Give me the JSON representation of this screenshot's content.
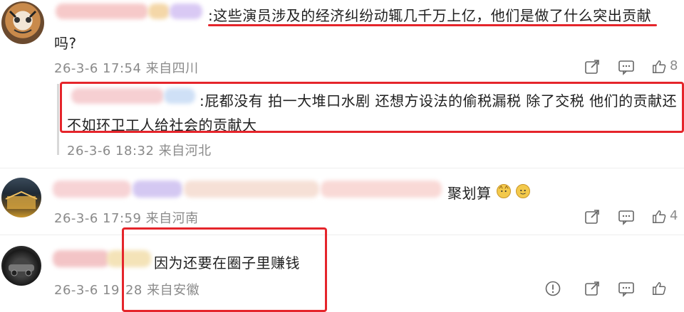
{
  "comments": [
    {
      "text_line1": ":这些演员涉及的经济纠纷动辄几千万上亿，他们是做了什么突出贡献",
      "text_line2": "吗?",
      "date": "26-3-6",
      "time": "17:54",
      "location": "来自四川",
      "like_count": "8",
      "reply": {
        "text_line1": ":屁都没有 拍一大堆口水剧 还想方设法的偷税漏税 除了交税 他们的贡献还",
        "text_line2": "不如环卫工人给社会的贡献大",
        "date": "26-3-6",
        "time": "18:32",
        "location": "来自河北"
      }
    },
    {
      "text": "聚划算",
      "date": "26-3-6",
      "time": "17:59",
      "location": "来自河南",
      "like_count": "4"
    },
    {
      "text": "因为还要在圈子里赚钱",
      "date": "26-3-6",
      "time_part1": "19",
      "time_part2": "28",
      "location": "来自安徽"
    }
  ],
  "colors": {
    "highlight": "#e5252b",
    "meta": "#8a8a8a"
  },
  "icons": [
    "share-icon",
    "comment-icon",
    "like-icon",
    "report-icon"
  ]
}
